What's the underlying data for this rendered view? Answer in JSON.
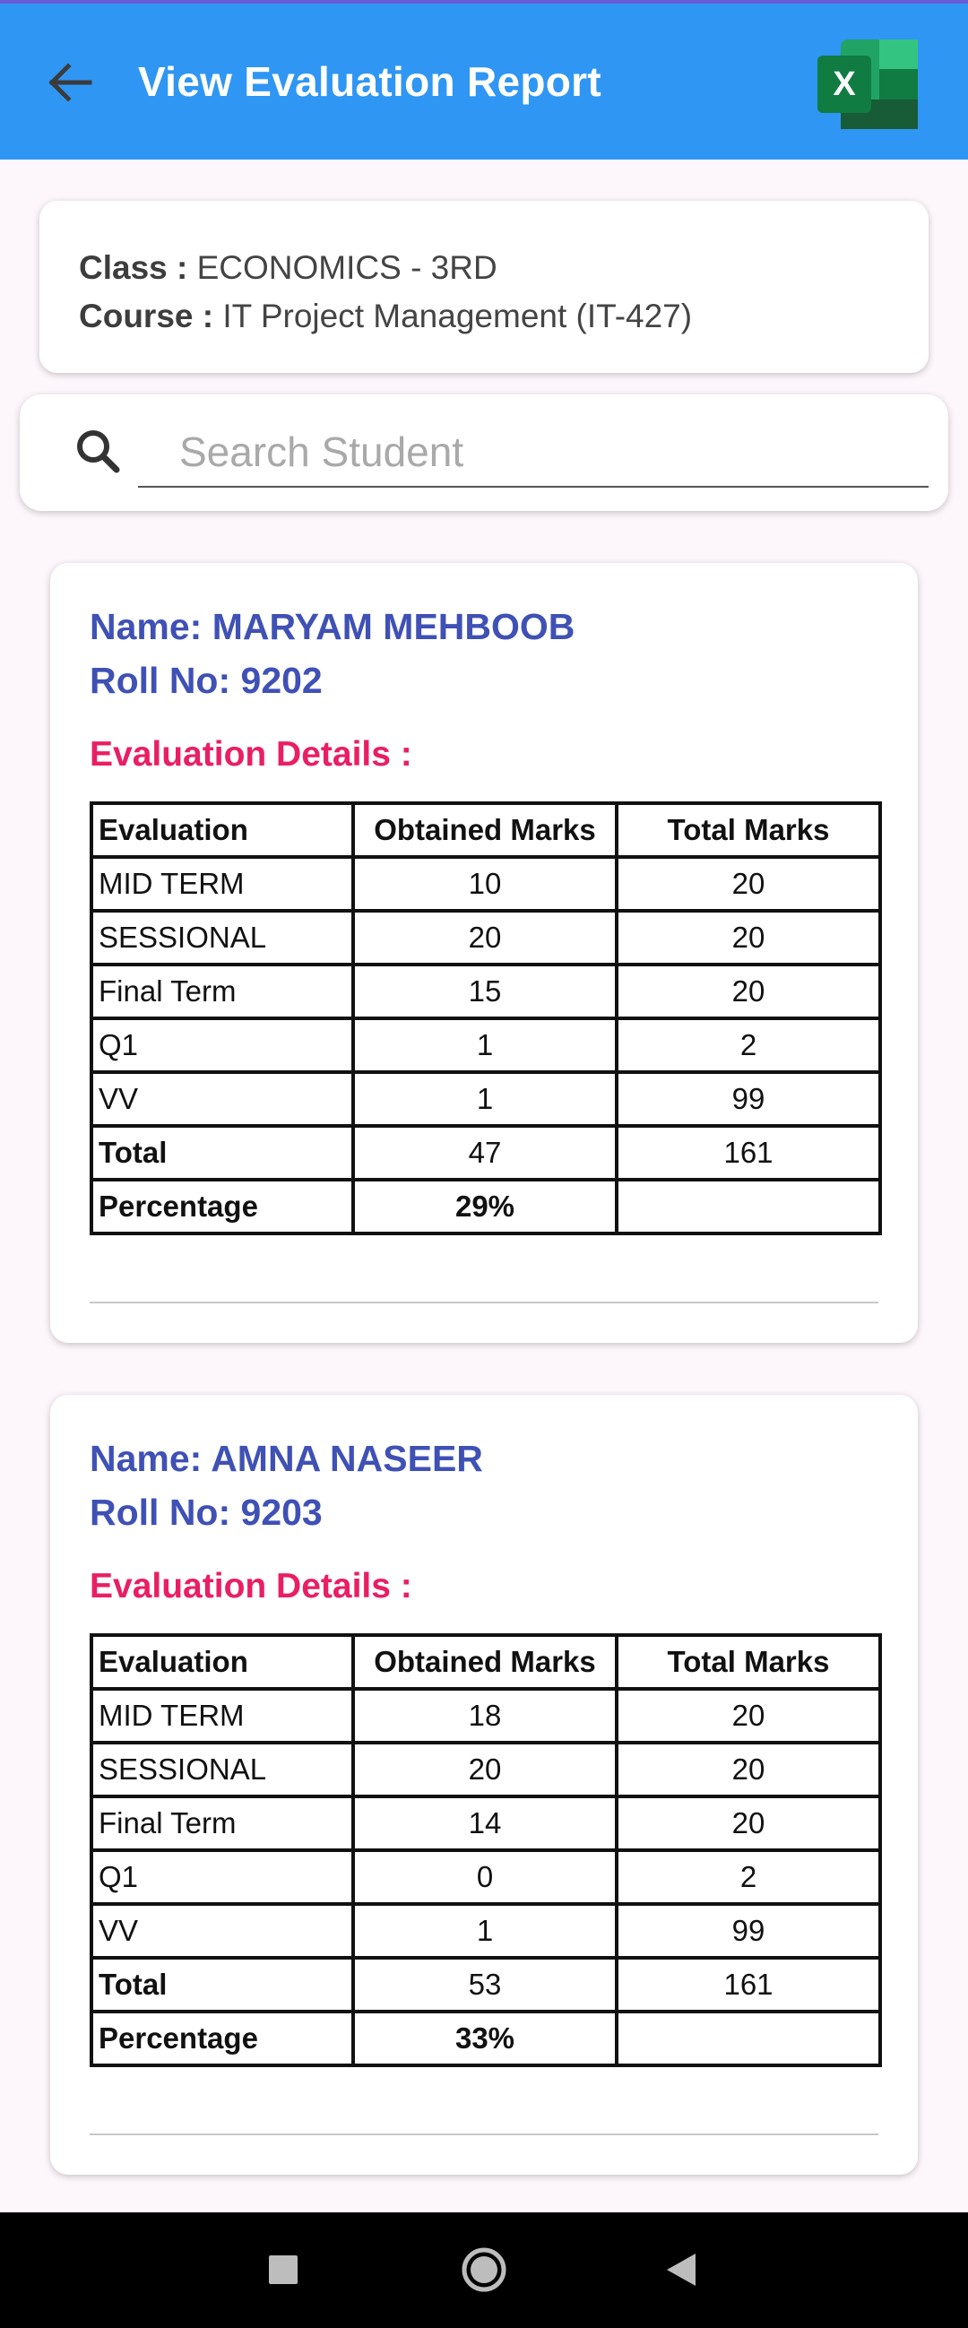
{
  "app_bar": {
    "title": "View Evaluation Report",
    "back_icon": "arrow-left-icon",
    "export_icon": "excel-icon",
    "export_icon_letter": "X",
    "background_color": "#2f96f3"
  },
  "info": {
    "class_label": "Class :",
    "class_value": "ECONOMICS - 3RD",
    "course_label": "Course :",
    "course_value": "IT Project Management (IT-427)"
  },
  "search": {
    "placeholder": "Search Student",
    "value": "",
    "icon": "search-icon"
  },
  "students": [
    {
      "name": "Name: MARYAM MEHBOOB",
      "roll": "Roll No: 9202",
      "details_heading": "Evaluation Details :",
      "headers": [
        "Evaluation",
        "Obtained Marks",
        "Total Marks"
      ],
      "rows": [
        [
          "MID TERM",
          "10",
          "20"
        ],
        [
          "SESSIONAL",
          "20",
          "20"
        ],
        [
          "Final Term",
          "15",
          "20"
        ],
        [
          "Q1",
          "1",
          "2"
        ],
        [
          "VV",
          "1",
          "99"
        ]
      ],
      "total": [
        "Total",
        "47",
        "161"
      ],
      "percentage": [
        "Percentage",
        "29%",
        ""
      ]
    },
    {
      "name": "Name: AMNA NASEER",
      "roll": "Roll No: 9203",
      "details_heading": "Evaluation Details :",
      "headers": [
        "Evaluation",
        "Obtained Marks",
        "Total Marks"
      ],
      "rows": [
        [
          "MID TERM",
          "18",
          "20"
        ],
        [
          "SESSIONAL",
          "20",
          "20"
        ],
        [
          "Final Term",
          "14",
          "20"
        ],
        [
          "Q1",
          "0",
          "2"
        ],
        [
          "VV",
          "1",
          "99"
        ]
      ],
      "total": [
        "Total",
        "53",
        "161"
      ],
      "percentage": [
        "Percentage",
        "33%",
        ""
      ]
    }
  ],
  "colors": {
    "name_color": "#3f51b5",
    "heading_color": "#e91e63",
    "excel_green": "#1d6f42"
  },
  "nav_bar": {
    "recents_icon": "square-icon",
    "home_icon": "circle-home-icon",
    "back_icon": "triangle-back-icon"
  }
}
